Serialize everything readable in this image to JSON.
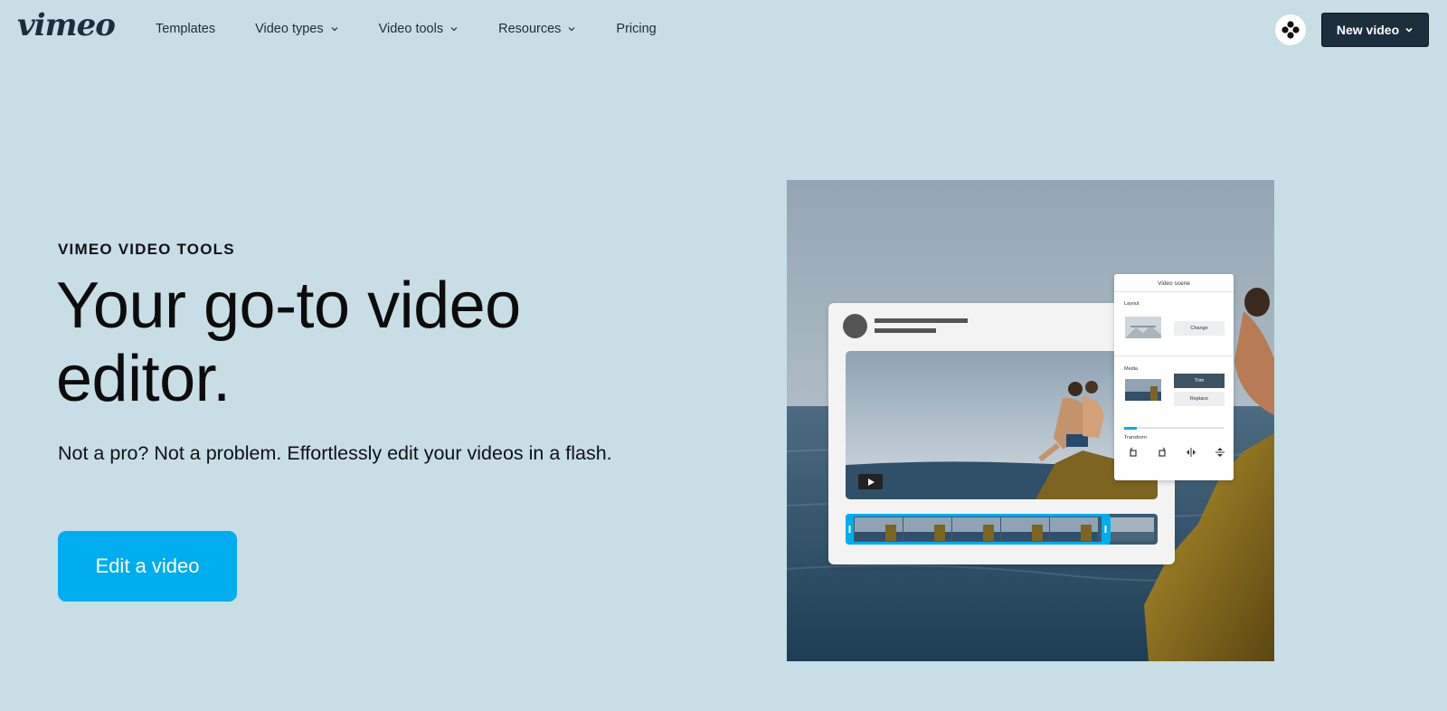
{
  "nav": {
    "logo": "vimeo",
    "links": [
      {
        "label": "Templates",
        "dropdown": false
      },
      {
        "label": "Video types",
        "dropdown": true
      },
      {
        "label": "Video tools",
        "dropdown": true
      },
      {
        "label": "Resources",
        "dropdown": true
      },
      {
        "label": "Pricing",
        "dropdown": false
      }
    ],
    "avatar_icon": "four-dot-icon",
    "new_video_label": "New video"
  },
  "hero": {
    "eyebrow": "VIMEO VIDEO TOOLS",
    "headline": "Your go-to video editor.",
    "subtext": "Not a pro? Not a problem. Effortlessly edit your videos in a flash.",
    "cta_label": "Edit a video"
  },
  "editor_panel": {
    "title": "Video scene",
    "layout_label": "Layout",
    "change_label": "Change",
    "media_label": "Media",
    "trim_label": "Trim",
    "replace_label": "Replace",
    "transform_label": "Transform",
    "transform_icons": [
      "rotate-left-icon",
      "rotate-right-icon",
      "flip-horizontal-icon",
      "flip-vertical-icon"
    ]
  },
  "colors": {
    "page_bg": "#c7dee6",
    "brand_dark": "#1a2e3b",
    "accent": "#00adef"
  }
}
